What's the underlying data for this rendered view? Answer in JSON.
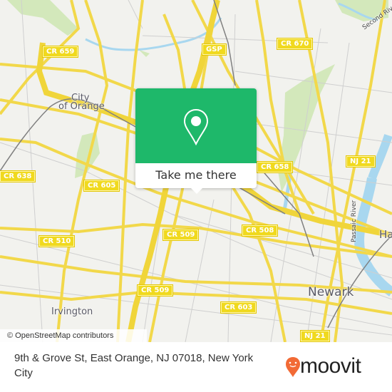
{
  "map": {
    "attribution": "© OpenStreetMap contributors",
    "colors": {
      "background": "#f2f2ee",
      "road_major": "#f6e27a",
      "road_minor": "#c9c9c9",
      "water": "#a8d7ef",
      "park": "#cfe6b4",
      "rail": "#777777"
    },
    "route_shields": [
      {
        "label": "CR 659"
      },
      {
        "label": "GSP"
      },
      {
        "label": "CR 670"
      },
      {
        "label": "CR 638"
      },
      {
        "label": "CR 605"
      },
      {
        "label": "CR 658"
      },
      {
        "label": "NJ 21"
      },
      {
        "label": "CR 510"
      },
      {
        "label": "CR 509"
      },
      {
        "label": "CR 508"
      },
      {
        "label": "CR 509"
      },
      {
        "label": "CR 603"
      },
      {
        "label": "NJ 21"
      }
    ],
    "place_labels": {
      "city_of_orange_1": "City",
      "city_of_orange_2": "of Orange",
      "irvington": "Irvington",
      "newark": "Newark",
      "harrison_partial": "Ha",
      "second_river": "Second River",
      "passaic_river": "Passaic River"
    }
  },
  "popup": {
    "icon": "location-pin-icon",
    "button_label": "Take me there",
    "accent_color": "#1eb86a"
  },
  "footer": {
    "address": "9th & Grove St, East Orange, NJ 07018, New York City",
    "logo_text": "moovit",
    "logo_color": "#f26a35"
  }
}
